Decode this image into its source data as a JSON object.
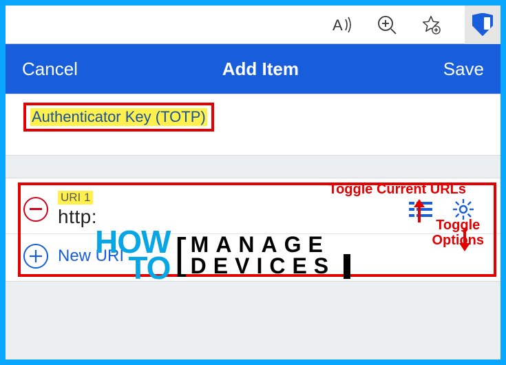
{
  "browser": {
    "tools": {
      "read_aloud": "read-aloud",
      "zoom": "zoom",
      "favorite": "favorite"
    },
    "extension": "bitwarden"
  },
  "header": {
    "cancel": "Cancel",
    "title": "Add Item",
    "save": "Save"
  },
  "fields": {
    "totp_label": "Authenticator Key (TOTP)"
  },
  "uri_section": {
    "items": [
      {
        "label": "URI 1",
        "value": "http:"
      }
    ],
    "new_uri": "New URI"
  },
  "annotations": {
    "toggle_urls": "Toggle Current URLs",
    "toggle_options_l1": "Toggle",
    "toggle_options_l2": "Options"
  },
  "watermark": {
    "how": "HOW",
    "to": "TO",
    "line1": "MANAGE",
    "line2": "DEVICES"
  }
}
